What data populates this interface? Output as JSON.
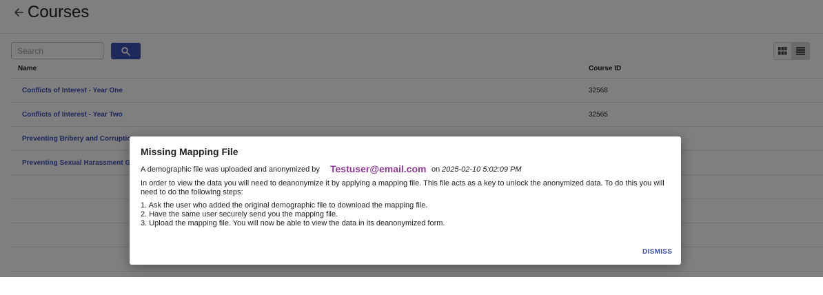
{
  "header": {
    "title": "Courses"
  },
  "search": {
    "placeholder": "Search"
  },
  "table": {
    "columns": {
      "name": "Name",
      "course_id": "Course ID"
    },
    "rows": [
      {
        "name": "Conflicts of Interest - Year One",
        "course_id": "32568"
      },
      {
        "name": "Conflicts of Interest - Year Two",
        "course_id": "32565"
      },
      {
        "name": "Preventing Bribery and Corruption",
        "course_id": ""
      },
      {
        "name": "Preventing Sexual Harassment Glob",
        "course_id": ""
      }
    ]
  },
  "dialog": {
    "title": "Missing Mapping File",
    "line1_prefix": "A demographic file was uploaded and anonymized by",
    "email": "Testuser@email.com",
    "on_text": "on",
    "timestamp": "2025-02-10 5:02:09 PM",
    "paragraph": "In order to view the data you will need to deanonymize it by applying a mapping file. This file acts as a key to unlock the anonymized data. To do this you will need to do the following steps:",
    "steps": [
      "1. Ask the user who added the original demographic file to download the mapping file.",
      "2. Have the same user securely send you the mapping file.",
      "3. Upload the mapping file. You will now be able to view the data in its deanonymized form."
    ],
    "dismiss_label": "DISMISS"
  },
  "colors": {
    "accent": "#3f51b5",
    "email": "#8e3a94"
  },
  "icons": {
    "back": "arrow-left-icon",
    "search": "search-icon",
    "grid": "grid-view-icon",
    "list": "list-view-icon"
  }
}
